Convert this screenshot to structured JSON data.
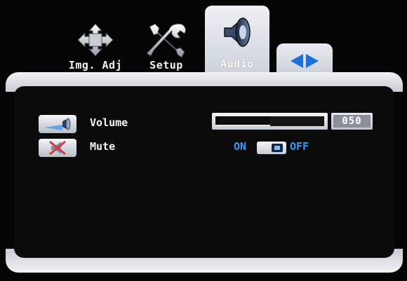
{
  "tabs": [
    {
      "label": "Img. Adj",
      "icon": "arrows-move-icon",
      "selected": false
    },
    {
      "label": "Setup",
      "icon": "wrench-screwdriver-icon",
      "selected": false
    },
    {
      "label": "Audio",
      "icon": "speaker-icon",
      "selected": true
    }
  ],
  "nav": {
    "icon": "left-right-arrows-icon"
  },
  "settings": {
    "volume": {
      "label": "Volume",
      "value": "050",
      "level_percent": 50,
      "icon": "speaker-volume-icon"
    },
    "mute": {
      "label": "Mute",
      "on_label": "ON",
      "off_label": "OFF",
      "state": "off",
      "icon": "mute-x-icon"
    }
  },
  "colors": {
    "accent_blue": "#2e9bff",
    "panel_silver": "#d4d7de",
    "background": "#050505"
  }
}
